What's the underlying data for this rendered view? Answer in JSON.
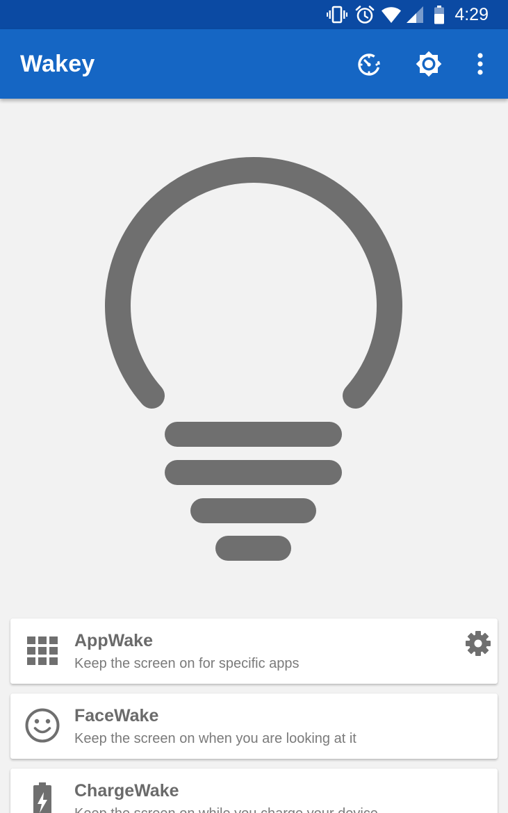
{
  "status_bar": {
    "time": "4:29",
    "icons": [
      "vibrate-icon",
      "alarm-icon",
      "wifi-icon",
      "cell-signal-icon",
      "battery-icon"
    ]
  },
  "app_bar": {
    "title": "Wakey",
    "actions": [
      "timer-icon",
      "brightness-icon",
      "more-vert-icon"
    ]
  },
  "bulb": {
    "state": "off",
    "color": "#6f6f6f"
  },
  "modes": [
    {
      "title": "AppWake",
      "subtitle": "Keep the screen on for specific apps",
      "icon": "apps-grid-icon",
      "has_settings": true
    },
    {
      "title": "FaceWake",
      "subtitle": "Keep the screen on when you are looking at it",
      "icon": "smiley-face-icon",
      "has_settings": false
    },
    {
      "title": "ChargeWake",
      "subtitle": "Keep the screen on while you charge your device",
      "icon": "battery-charging-icon",
      "has_settings": false
    }
  ],
  "colors": {
    "status_bar": "#0b4aa3",
    "app_bar": "#1566c4",
    "background": "#f2f2f2",
    "icon_gray": "#6f6f6f"
  }
}
